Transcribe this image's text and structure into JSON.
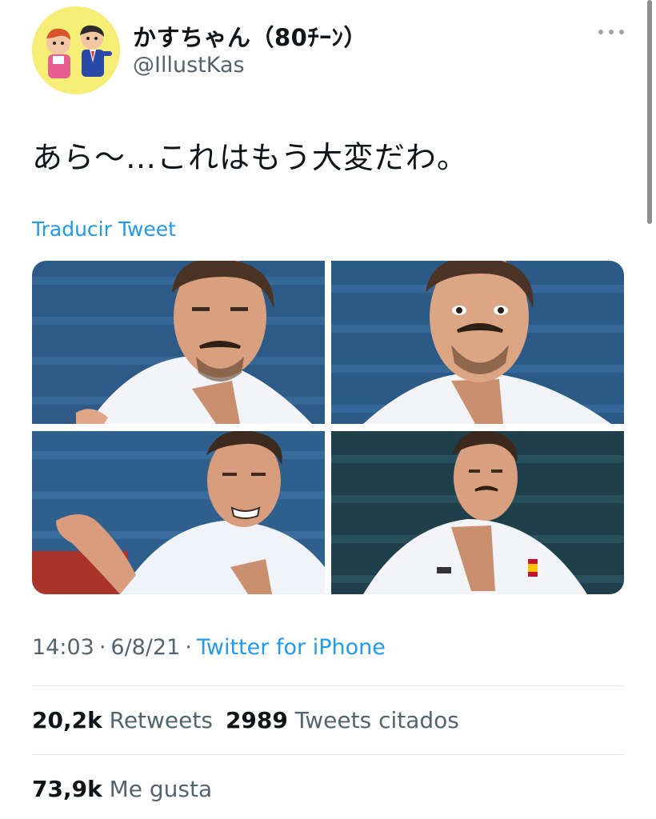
{
  "author": {
    "display_name": "かすちゃん（80ﾁｰﾝ）",
    "handle": "@IllustKas"
  },
  "tweet": {
    "text": "あら～…これはもう大変だわ。",
    "translate_label": "Traducir Tweet"
  },
  "meta": {
    "time": "14:03",
    "date": "6/8/21",
    "source": "Twitter for iPhone"
  },
  "stats": {
    "retweets_count": "20,2k",
    "retweets_label": "Retweets",
    "quotes_count": "2989",
    "quotes_label": "Tweets citados",
    "likes_count": "73,9k",
    "likes_label": "Me gusta"
  },
  "icons": {
    "more": "more-options-icon"
  },
  "colors": {
    "link": "#1d9bf0",
    "secondary_text": "#536471",
    "primary_text": "#0f1419",
    "avatar_bg": "#f7ee78"
  }
}
